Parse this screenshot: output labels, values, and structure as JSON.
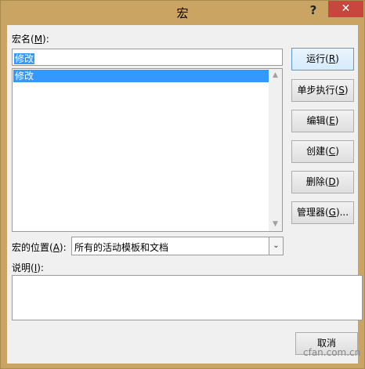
{
  "window": {
    "title": "宏"
  },
  "titlebar": {
    "help_label": "?",
    "close_label": "✕"
  },
  "macro_name": {
    "label_pre": "宏名(",
    "label_key": "M",
    "label_post": "):",
    "value": "修改"
  },
  "macro_list": {
    "items": [
      "修改"
    ]
  },
  "scrollbar": {
    "up_arrow": "▲",
    "down_arrow": "▼"
  },
  "buttons": [
    {
      "label_pre": "运行(",
      "key": "R",
      "label_post": ")"
    },
    {
      "label_pre": "单步执行(",
      "key": "S",
      "label_post": ")"
    },
    {
      "label_pre": "编辑(",
      "key": "E",
      "label_post": ")"
    },
    {
      "label_pre": "创建(",
      "key": "C",
      "label_post": ")"
    },
    {
      "label_pre": "删除(",
      "key": "D",
      "label_post": ")"
    },
    {
      "label_pre": "管理器(",
      "key": "G",
      "label_post": ")..."
    }
  ],
  "location": {
    "label_pre": "宏的位置(",
    "label_key": "A",
    "label_post": "):",
    "selected": "所有的活动模板和文档",
    "dropdown_icon": "⌄"
  },
  "description": {
    "label_pre": "说明(",
    "label_key": "I",
    "label_post": "):",
    "value": ""
  },
  "cancel": {
    "label": "取消"
  },
  "watermark": {
    "text": "cfan.com.cn"
  }
}
